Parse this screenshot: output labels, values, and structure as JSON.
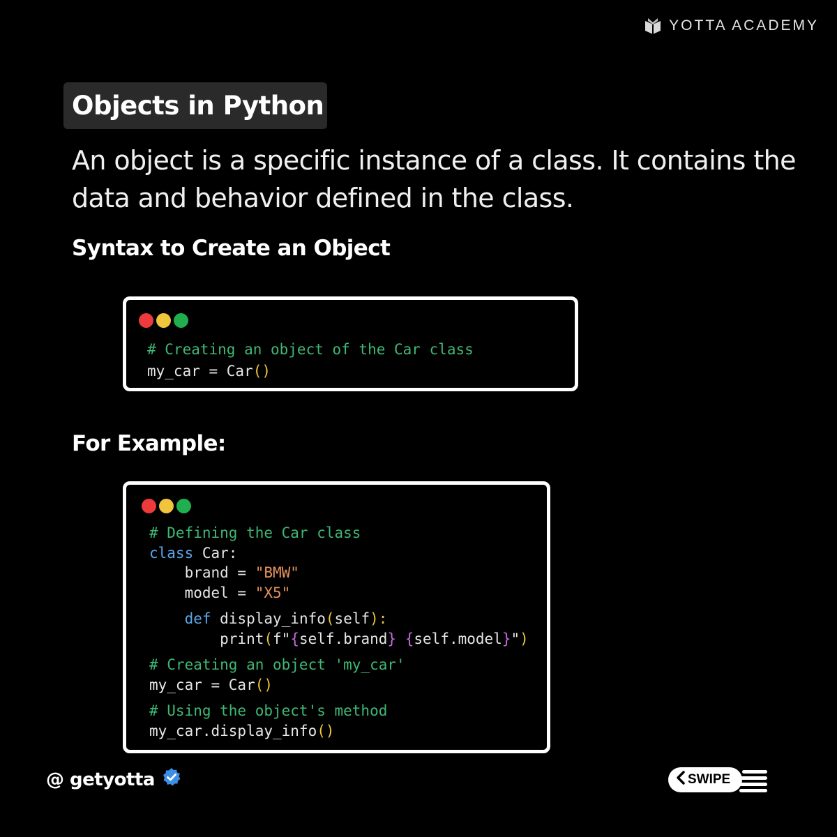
{
  "brand": {
    "name": "YOTTA ACADEMY",
    "logo_icon": "book-logo-icon"
  },
  "title": "Objects in Python",
  "description": "An object is a specific instance of a class. It contains the data and behavior defined in the class.",
  "syntax_heading": "Syntax to Create an Object",
  "syntax_code": {
    "comment": "# Creating an object of the Car class",
    "line_var": "my_car = Car",
    "line_parens": "()"
  },
  "example_heading": "For Example:",
  "example_code": {
    "comment1": "# Defining the Car class",
    "class_kw": "class",
    "class_name": " Car:",
    "brand_lhs": "    brand = ",
    "brand_val": "\"BMW\"",
    "model_lhs": "    model = ",
    "model_val": "\"X5\"",
    "def_kw": "    def",
    "def_rest": " display_info",
    "def_open": "(",
    "def_self": "self",
    "def_close": "):",
    "print_name": "        print",
    "print_open": "(",
    "print_f": "f\"",
    "print_b1o": "{",
    "print_self_brand": "self.brand",
    "print_b1c": "}",
    "print_space": " ",
    "print_b2o": "{",
    "print_self_model": "self.model",
    "print_b2c": "}",
    "print_q": "\"",
    "print_close": ")",
    "comment2": "# Creating an object 'my_car'",
    "obj_line": "my_car = Car",
    "obj_parens": "()",
    "comment3": "# Using the object's method",
    "call_line": "my_car.display_info",
    "call_parens": "()"
  },
  "footer": {
    "handle": "@ getyotta",
    "verified_icon": "verified-badge-icon",
    "swipe_label": "SWIPE",
    "swipe_icon": "chevron-left-icon"
  },
  "colors": {
    "background": "#000000",
    "comment": "#3fb873",
    "keyword": "#5ba6ea",
    "string": "#e5925a",
    "paren": "#f0c53b",
    "brace": "#c56be0",
    "verified": "#3d8ee6"
  }
}
